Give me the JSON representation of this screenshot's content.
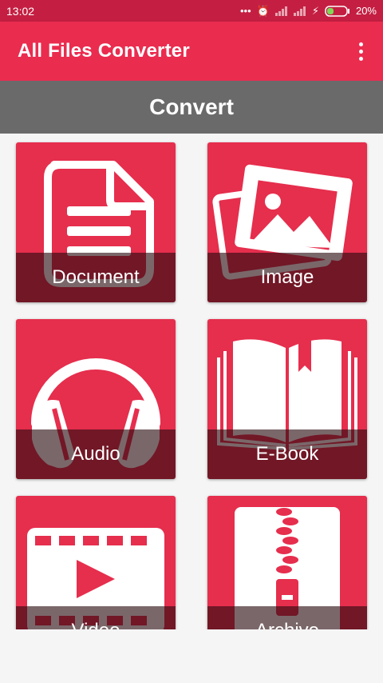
{
  "status_bar": {
    "time": "13:02",
    "battery": "20%"
  },
  "app_bar": {
    "title": "All Files Converter",
    "menu_icon": "more-vert-icon"
  },
  "section": {
    "title": "Convert"
  },
  "tiles": [
    {
      "label": "Document",
      "icon": "document-icon"
    },
    {
      "label": "Image",
      "icon": "image-icon"
    },
    {
      "label": "Audio",
      "icon": "headphones-icon"
    },
    {
      "label": "E-Book",
      "icon": "book-icon"
    },
    {
      "label": "Video",
      "icon": "film-icon"
    },
    {
      "label": "Archive",
      "icon": "archive-zip-icon"
    }
  ],
  "colors": {
    "status_bar": "#c41f42",
    "app_bar": "#ea2c4f",
    "tile": "#e62e4d",
    "header": "#6a6a6a"
  }
}
